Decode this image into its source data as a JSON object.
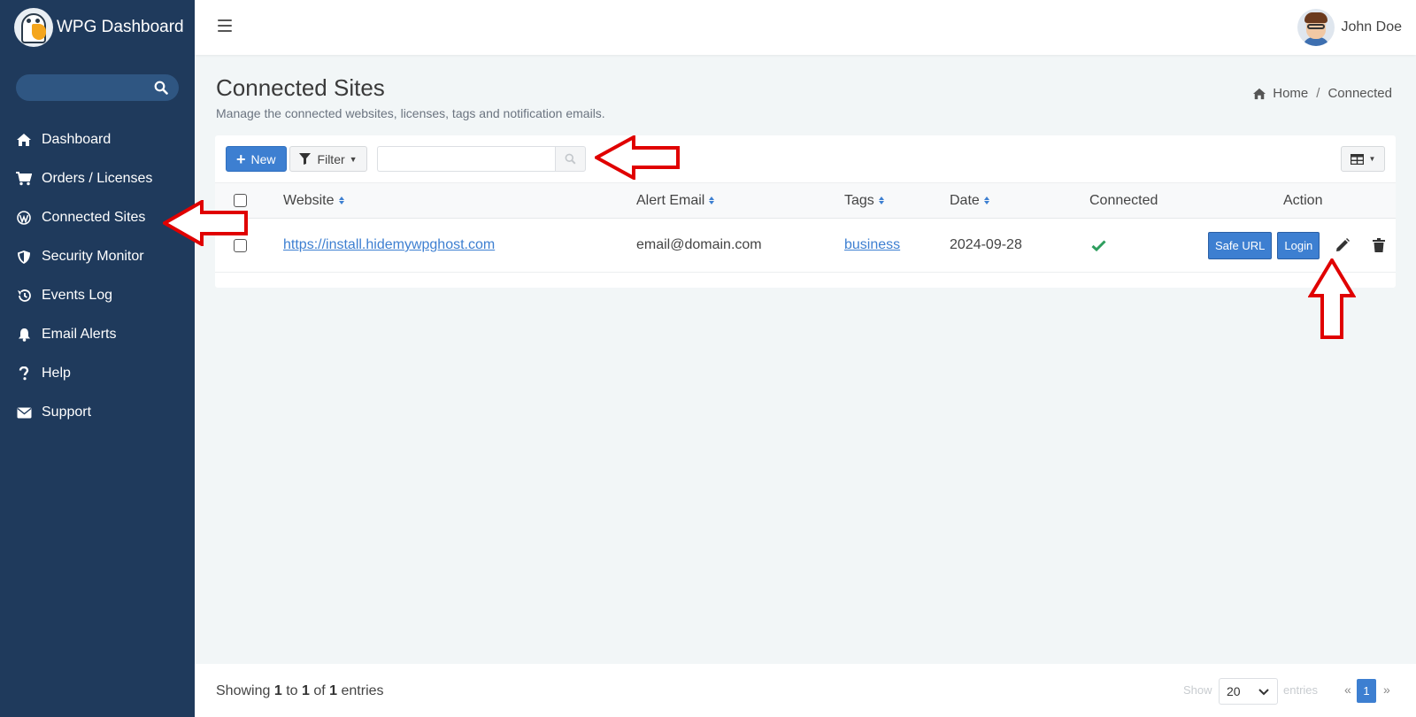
{
  "app": {
    "title": "WPG Dashboard",
    "user_name": "John Doe"
  },
  "sidebar": {
    "items": [
      {
        "label": "Dashboard",
        "icon": "home-icon"
      },
      {
        "label": "Orders / Licenses",
        "icon": "cart-icon"
      },
      {
        "label": "Connected Sites",
        "icon": "wordpress-icon"
      },
      {
        "label": "Security Monitor",
        "icon": "shield-icon"
      },
      {
        "label": "Events Log",
        "icon": "history-icon"
      },
      {
        "label": "Email Alerts",
        "icon": "bell-icon"
      },
      {
        "label": "Help",
        "icon": "question-icon"
      },
      {
        "label": "Support",
        "icon": "envelope-icon"
      }
    ]
  },
  "page": {
    "title": "Connected Sites",
    "subtitle": "Manage the connected websites, licenses, tags and notification emails."
  },
  "breadcrumb": {
    "home": "Home",
    "current": "Connected"
  },
  "toolbar": {
    "new_label": "New",
    "filter_label": "Filter",
    "search_value": ""
  },
  "table": {
    "columns": [
      "Website",
      "Alert Email",
      "Tags",
      "Date",
      "Connected",
      "Action"
    ],
    "rows": [
      {
        "website": "https://install.hidemywpghost.com",
        "alert_email": "email@domain.com",
        "tags": "business",
        "date": "2024-09-28",
        "connected": true
      }
    ],
    "row_actions": {
      "safe_url": "Safe URL",
      "login": "Login"
    }
  },
  "footer": {
    "showing_prefix": "Showing",
    "from": "1",
    "to_word": "to",
    "to": "1",
    "of_word": "of",
    "total": "1",
    "entries_word": "entries",
    "show_label": "Show",
    "page_size": "20",
    "entries_label": "entries",
    "prev": "«",
    "current_page": "1",
    "next": "»"
  },
  "colors": {
    "sidebar_bg": "#1f3a5c",
    "accent": "#3d7fd1",
    "annotation_arrow": "#e00000",
    "connected_check": "#2e9e5e"
  }
}
